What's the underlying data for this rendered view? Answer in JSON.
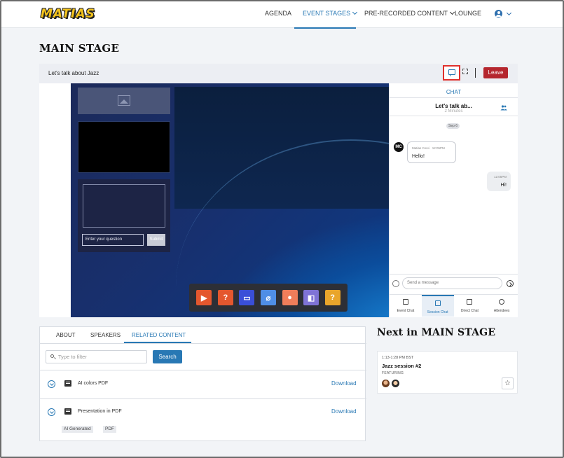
{
  "app": {
    "logo_text": "MATIAS"
  },
  "nav": {
    "items": [
      {
        "label": "AGENDA"
      },
      {
        "label": "EVENT STAGES"
      },
      {
        "label": "PRE-RECORDED CONTENT"
      },
      {
        "label": "LOUNGE"
      }
    ],
    "active": "EVENT STAGES",
    "user_icon": "user-circle-icon"
  },
  "page": {
    "title": "MAIN STAGE"
  },
  "session": {
    "name": "Let's talk about Jazz",
    "leave_label": "Leave"
  },
  "qa": {
    "placeholder": "Enter your question",
    "submit_label": "Submit"
  },
  "toolbar": {
    "buttons": [
      {
        "icon": "video-play-icon",
        "color": "#e4572e"
      },
      {
        "icon": "question-bubble-icon",
        "color": "#e4572e",
        "glyph": "?"
      },
      {
        "icon": "presentation-icon",
        "color": "#3a4fd8"
      },
      {
        "icon": "paperclip-icon",
        "color": "#4f8ee6"
      },
      {
        "icon": "person-icon",
        "color": "#f07d5a"
      },
      {
        "icon": "screen-pointer-icon",
        "color": "#7f73d6"
      },
      {
        "icon": "help-icon",
        "color": "#e9a52b",
        "glyph": "?"
      }
    ]
  },
  "chat": {
    "header": "CHAT",
    "session_title": "Let's talk ab...",
    "session_sub": "2 Minutes",
    "date_label": "Sep 6",
    "messages": [
      {
        "avatar": "MC",
        "author": "Matias Cervi",
        "time": "12:05PM",
        "text": "Hello!"
      },
      {
        "time": "12:05PM",
        "text": "Hi!"
      }
    ],
    "input_placeholder": "Send a message",
    "tabs": [
      {
        "label": "Event Chat"
      },
      {
        "label": "Session Chat"
      },
      {
        "label": "Direct Chat"
      },
      {
        "label": "Attendees"
      }
    ]
  },
  "info": {
    "tabs": [
      {
        "label": "ABOUT"
      },
      {
        "label": "SPEAKERS"
      },
      {
        "label": "RELATED CONTENT"
      }
    ],
    "active_tab": "RELATED CONTENT",
    "filter_placeholder": "Type to filter",
    "search_label": "Search",
    "files": [
      {
        "name": "AI colors PDF",
        "action": "Download"
      },
      {
        "name": "Presentation in PDF",
        "action": "Download"
      }
    ],
    "tags": [
      "AI Generated",
      "PDF"
    ]
  },
  "next": {
    "title": "Next in MAIN STAGE",
    "time": "1:13-1:28 PM BST",
    "name": "Jazz session #2",
    "featuring": "FEATURING"
  },
  "colors": {
    "accent": "#2878b4",
    "leave": "#b5262e",
    "highlight": "#e0312d"
  }
}
